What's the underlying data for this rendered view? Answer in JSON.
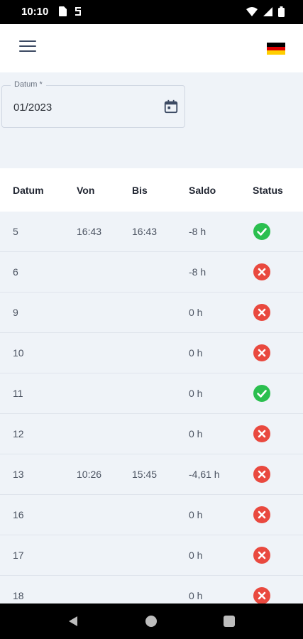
{
  "status_bar": {
    "time": "10:10"
  },
  "form": {
    "date_label": "Datum *",
    "date_value": "01/2023"
  },
  "table": {
    "columns": [
      "Datum",
      "Von",
      "Bis",
      "Saldo",
      "Status"
    ],
    "rows": [
      {
        "datum": "5",
        "von": "16:43",
        "bis": "16:43",
        "saldo": "-8 h",
        "status": "ok"
      },
      {
        "datum": "6",
        "von": "",
        "bis": "",
        "saldo": "-8 h",
        "status": "error"
      },
      {
        "datum": "9",
        "von": "",
        "bis": "",
        "saldo": "0 h",
        "status": "error"
      },
      {
        "datum": "10",
        "von": "",
        "bis": "",
        "saldo": "0 h",
        "status": "error"
      },
      {
        "datum": "11",
        "von": "",
        "bis": "",
        "saldo": "0 h",
        "status": "ok"
      },
      {
        "datum": "12",
        "von": "",
        "bis": "",
        "saldo": "0 h",
        "status": "error"
      },
      {
        "datum": "13",
        "von": "10:26",
        "bis": "15:45",
        "saldo": "-4,61 h",
        "status": "error"
      },
      {
        "datum": "16",
        "von": "",
        "bis": "",
        "saldo": "0 h",
        "status": "error"
      },
      {
        "datum": "17",
        "von": "",
        "bis": "",
        "saldo": "0 h",
        "status": "error"
      },
      {
        "datum": "18",
        "von": "",
        "bis": "",
        "saldo": "0 h",
        "status": "error"
      }
    ]
  },
  "colors": {
    "ok": "#2bbf4f",
    "error": "#e9493f",
    "flag": [
      "#000000",
      "#dd0000",
      "#ffce00"
    ]
  },
  "icons": {
    "menu": "hamburger-icon",
    "language": "german-flag-icon",
    "calendar": "calendar-icon",
    "ok": "check-circle-icon",
    "error": "x-circle-icon"
  }
}
